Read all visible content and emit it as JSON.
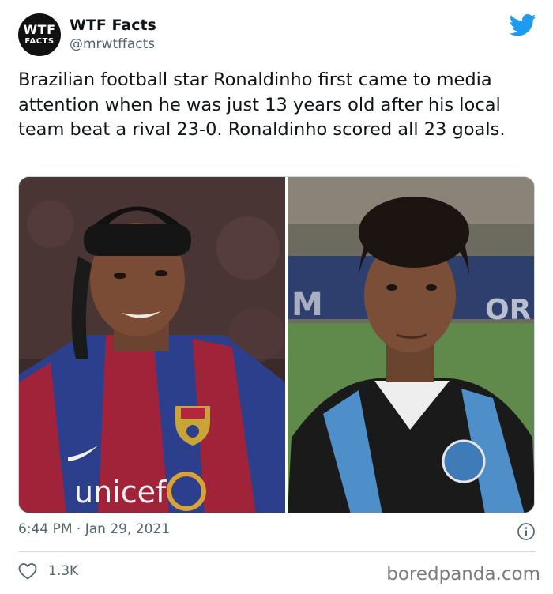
{
  "author": {
    "display_name": "WTF Facts",
    "handle": "@mrwtffacts",
    "avatar_line1": "WTF",
    "avatar_line2": "FACTS",
    "avatar_color": "#111111"
  },
  "tweet": {
    "text": "Brazilian football star Ronaldinho first came to media attention when he was just 13 years old after his local team beat a rival 23-0. Ronaldinho scored all 23 goals.",
    "timestamp": "6:44 PM · Jan 29, 2021",
    "likes": "1.3K"
  },
  "media": {
    "left_image": "adult-ronaldinho-barcelona-photo",
    "right_image": "young-ronaldinho-gremio-photo",
    "left_shirt_text": "unicef"
  },
  "icons": {
    "brand": "twitter-bird-icon",
    "info": "info-icon",
    "like": "heart-icon"
  },
  "colors": {
    "twitter_blue": "#1d9bf0",
    "secondary_text": "#536471"
  },
  "watermark": "boredpanda.com"
}
